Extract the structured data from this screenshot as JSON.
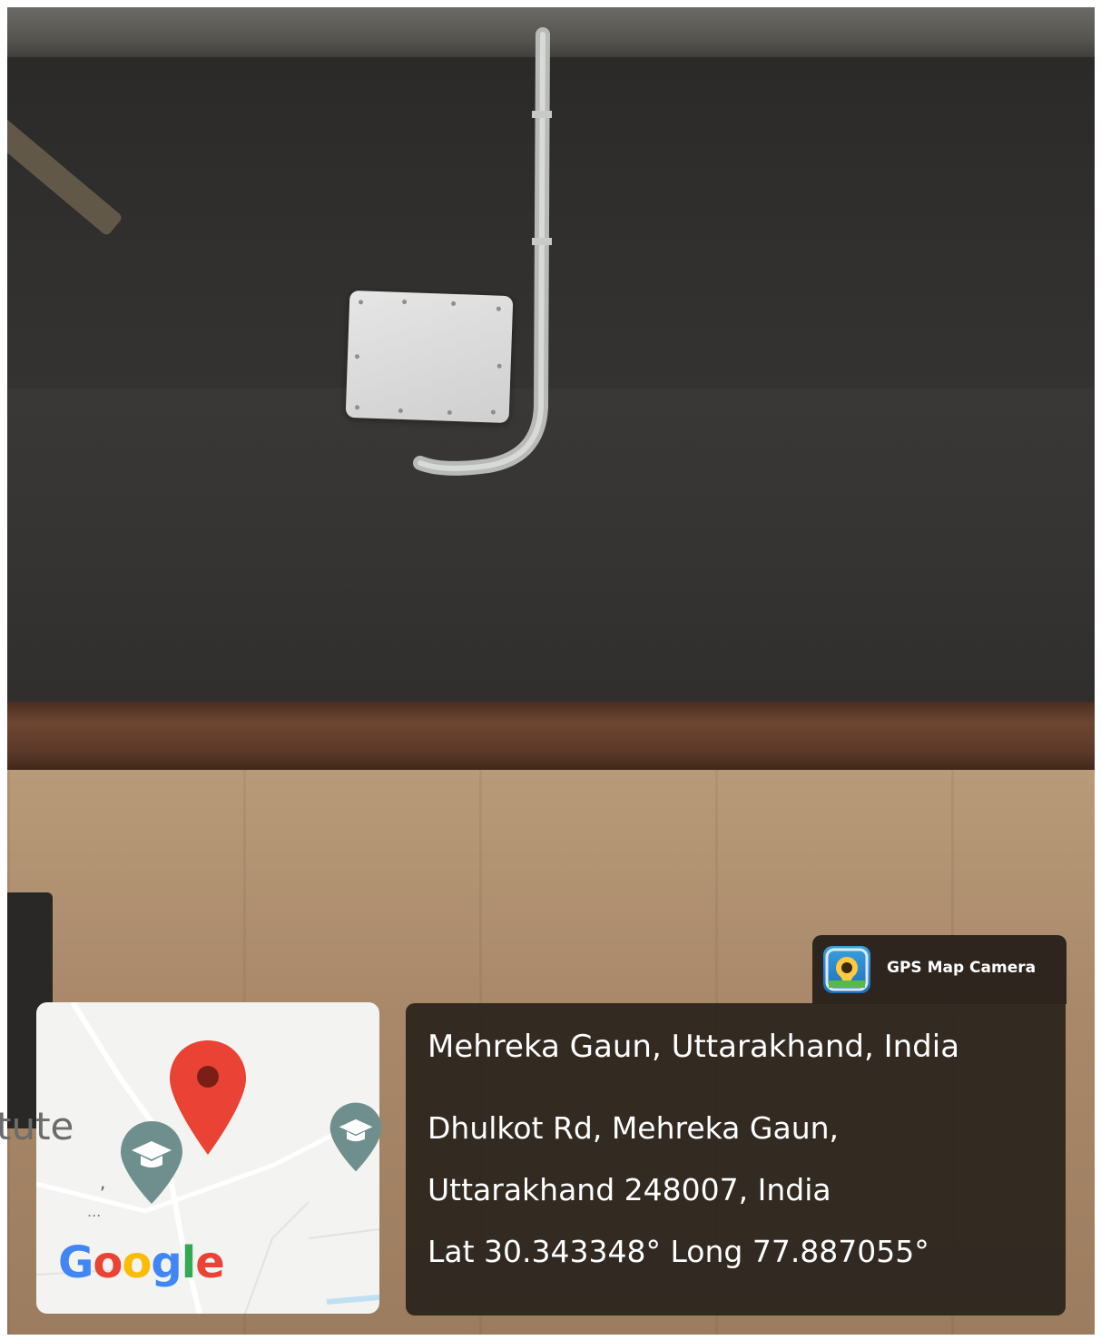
{
  "overlay": {
    "app_name": "GPS Map Camera",
    "place_title": "Mehreka Gaun, Uttarakhand, India",
    "address_line1": "Dhulkot Rd, Mehreka Gaun,",
    "address_line2": "Uttarakhand 248007, India",
    "coordinates": "Lat 30.343348° Long 77.887055°"
  },
  "map": {
    "partial_label": "tute",
    "comma_mark": ",",
    "dots_mark": "...",
    "brand": [
      "G",
      "o",
      "o",
      "g",
      "l",
      "e"
    ],
    "brand_colors": [
      "#4285F4",
      "#EA4335",
      "#FBBC05",
      "#4285F4",
      "#34A853",
      "#EA4335"
    ],
    "pin_color": "#EA4335",
    "school_pin_color": "#6f8f8f",
    "icons": [
      "location-pin-icon",
      "school-icon",
      "school-icon",
      "gps-map-camera-icon"
    ]
  }
}
